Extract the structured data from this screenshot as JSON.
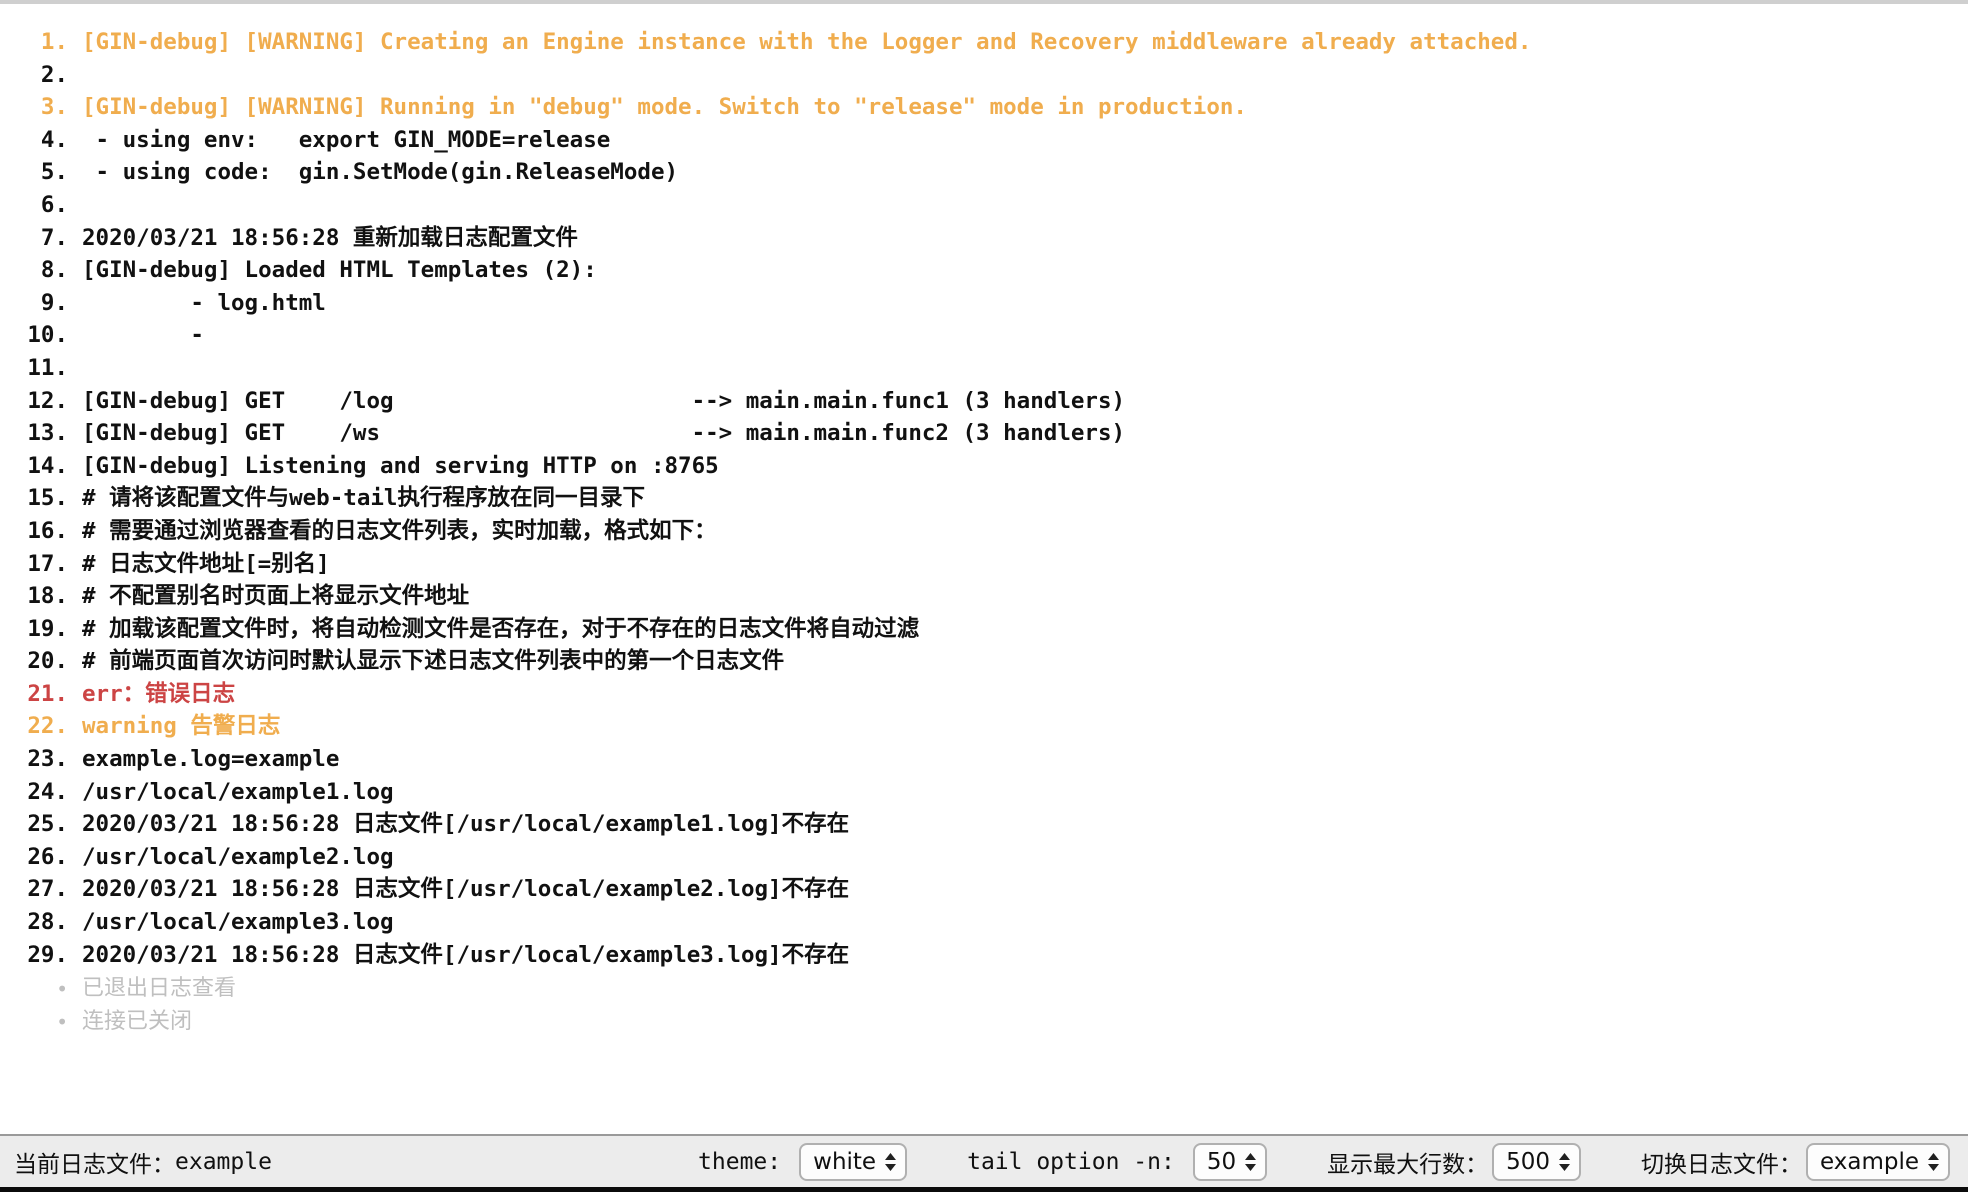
{
  "window": {
    "fullscreen_icon": "expand-fullscreen-icon",
    "accent_color": "#2f7cf6"
  },
  "colors": {
    "warning": "#f0ad4e",
    "error": "#cc4444",
    "normal": "#111111",
    "muted": "#bfbfbf",
    "toolbar_bg": "#ececec"
  },
  "log": {
    "lines": [
      {
        "n": "1.",
        "text": "[GIN-debug] [WARNING] Creating an Engine instance with the Logger and Recovery middleware already attached.",
        "level": "warn"
      },
      {
        "n": "2.",
        "text": "",
        "level": "normal"
      },
      {
        "n": "3.",
        "text": "[GIN-debug] [WARNING] Running in \"debug\" mode. Switch to \"release\" mode in production.",
        "level": "warn"
      },
      {
        "n": "4.",
        "text": " - using env:   export GIN_MODE=release",
        "level": "normal"
      },
      {
        "n": "5.",
        "text": " - using code:  gin.SetMode(gin.ReleaseMode)",
        "level": "normal"
      },
      {
        "n": "6.",
        "text": "",
        "level": "normal"
      },
      {
        "n": "7.",
        "text": "2020/03/21 18:56:28 重新加载日志配置文件",
        "level": "normal"
      },
      {
        "n": "8.",
        "text": "[GIN-debug] Loaded HTML Templates (2):",
        "level": "normal"
      },
      {
        "n": "9.",
        "text": "        - log.html",
        "level": "normal"
      },
      {
        "n": "10.",
        "text": "        -",
        "level": "normal"
      },
      {
        "n": "11.",
        "text": "",
        "level": "normal"
      },
      {
        "n": "12.",
        "text": "[GIN-debug] GET    /log                      --> main.main.func1 (3 handlers)",
        "level": "normal"
      },
      {
        "n": "13.",
        "text": "[GIN-debug] GET    /ws                       --> main.main.func2 (3 handlers)",
        "level": "normal"
      },
      {
        "n": "14.",
        "text": "[GIN-debug] Listening and serving HTTP on :8765",
        "level": "normal"
      },
      {
        "n": "15.",
        "text": "# 请将该配置文件与web-tail执行程序放在同一目录下",
        "level": "normal"
      },
      {
        "n": "16.",
        "text": "# 需要通过浏览器查看的日志文件列表，实时加载，格式如下：",
        "level": "normal"
      },
      {
        "n": "17.",
        "text": "# 日志文件地址[=别名]",
        "level": "normal"
      },
      {
        "n": "18.",
        "text": "# 不配置别名时页面上将显示文件地址",
        "level": "normal"
      },
      {
        "n": "19.",
        "text": "# 加载该配置文件时，将自动检测文件是否存在，对于不存在的日志文件将自动过滤",
        "level": "normal"
      },
      {
        "n": "20.",
        "text": "# 前端页面首次访问时默认显示下述日志文件列表中的第一个日志文件",
        "level": "normal"
      },
      {
        "n": "21.",
        "text": "err：错误日志",
        "level": "err"
      },
      {
        "n": "22.",
        "text": "warning 告警日志",
        "level": "warn"
      },
      {
        "n": "23.",
        "text": "example.log=example",
        "level": "normal"
      },
      {
        "n": "24.",
        "text": "/usr/local/example1.log",
        "level": "normal"
      },
      {
        "n": "25.",
        "text": "2020/03/21 18:56:28 日志文件[/usr/local/example1.log]不存在",
        "level": "normal"
      },
      {
        "n": "26.",
        "text": "/usr/local/example2.log",
        "level": "normal"
      },
      {
        "n": "27.",
        "text": "2020/03/21 18:56:28 日志文件[/usr/local/example2.log]不存在",
        "level": "normal"
      },
      {
        "n": "28.",
        "text": "/usr/local/example3.log",
        "level": "normal"
      },
      {
        "n": "29.",
        "text": "2020/03/21 18:56:28 日志文件[/usr/local/example3.log]不存在",
        "level": "normal"
      }
    ],
    "status_messages": [
      {
        "bullet": "•",
        "text": "已退出日志查看"
      },
      {
        "bullet": "•",
        "text": "连接已关闭"
      }
    ]
  },
  "toolbar": {
    "current_file_label": "当前日志文件：",
    "current_file_value": "example",
    "theme_label": "theme:",
    "theme_value": "white",
    "theme_options": [
      "white"
    ],
    "tail_label": "tail option -n:",
    "tail_value": "50",
    "tail_options": [
      "50"
    ],
    "maxlines_label": "显示最大行数：",
    "maxlines_value": "500",
    "maxlines_options": [
      "500"
    ],
    "switchfile_label": "切换日志文件：",
    "switchfile_value": "example",
    "switchfile_options": [
      "example"
    ]
  }
}
